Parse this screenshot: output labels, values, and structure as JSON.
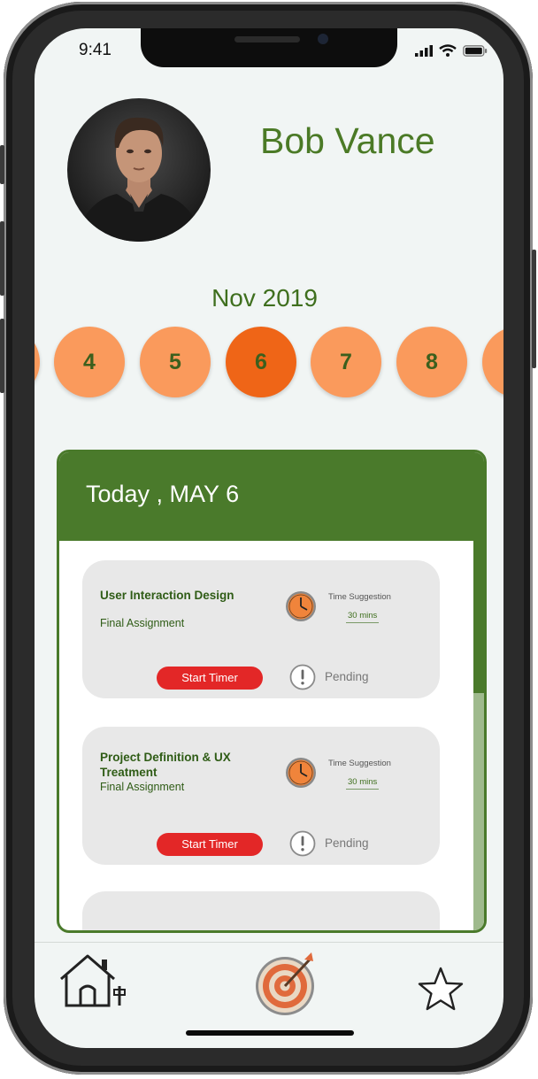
{
  "status_bar": {
    "time": "9:41"
  },
  "profile": {
    "name": "Bob Vance"
  },
  "calendar": {
    "month_label": "Nov 2019",
    "days": [
      "",
      "4",
      "5",
      "6",
      "7",
      "8",
      ""
    ],
    "selected_day": "6"
  },
  "schedule": {
    "header": "Today , MAY 6",
    "tasks": [
      {
        "title": "User Interaction Design",
        "subtitle": "Final Assignment",
        "time_label": "Time Suggestion",
        "time_value": "30 mins",
        "button_label": "Start Timer",
        "status": "Pending"
      },
      {
        "title": "Project Definition & UX Treatment",
        "subtitle": "Final Assignment",
        "time_label": "Time Suggestion",
        "time_value": "30 mins",
        "button_label": "Start Timer",
        "status": "Pending"
      }
    ]
  },
  "tabbar": {
    "items": [
      "home-icon",
      "target-icon",
      "star-icon"
    ]
  },
  "colors": {
    "brand_green": "#4a7a2b",
    "day_circle": "#fa9a5c",
    "day_selected": "#ef6517",
    "start_button": "#e32727",
    "screen_bg": "#f1f5f4"
  }
}
